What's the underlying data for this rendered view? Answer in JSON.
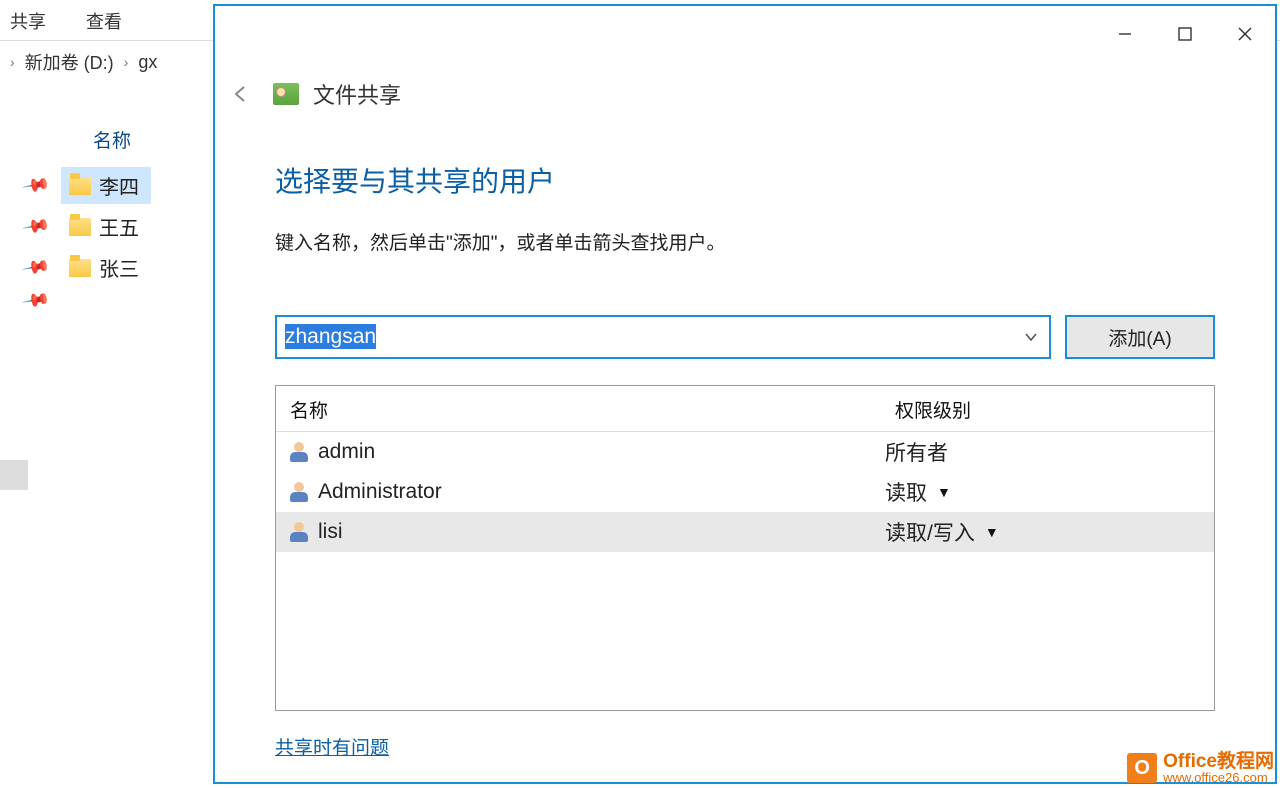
{
  "explorer": {
    "tabs": {
      "share": "共享",
      "view": "查看"
    },
    "breadcrumb": {
      "drive": "新加卷 (D:)",
      "folder": "gx"
    },
    "sidebar_header": "名称",
    "folders": [
      {
        "name": "李四",
        "selected": true
      },
      {
        "name": "王五",
        "selected": false
      },
      {
        "name": "张三",
        "selected": false
      }
    ]
  },
  "dialog": {
    "title": "文件共享",
    "heading": "选择要与其共享的用户",
    "instruction": "键入名称，然后单击\"添加\"，或者单击箭头查找用户。",
    "input_value": "zhangsan",
    "add_button": "添加(A)",
    "columns": {
      "name": "名称",
      "permission": "权限级别"
    },
    "rows": [
      {
        "name": "admin",
        "permission": "所有者",
        "dropdown": false,
        "highlight": false
      },
      {
        "name": "Administrator",
        "permission": "读取",
        "dropdown": true,
        "highlight": false
      },
      {
        "name": "lisi",
        "permission": "读取/写入",
        "dropdown": true,
        "highlight": true
      }
    ],
    "help_link": "共享时有问题"
  },
  "watermark": {
    "brand": "Office教程网",
    "url": "www.office26.com"
  }
}
